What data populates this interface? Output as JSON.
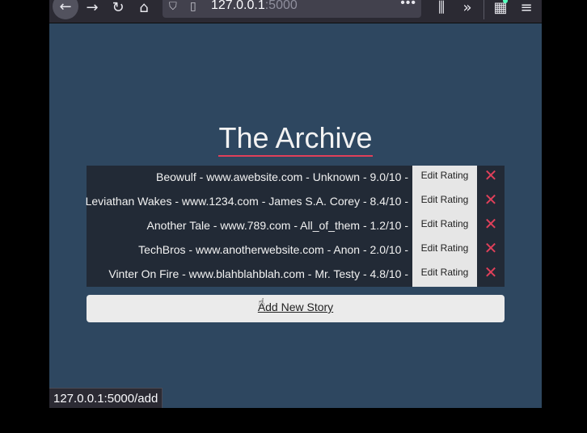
{
  "browser": {
    "url_host": "127.0.0.1",
    "url_port": ":5000",
    "status_url": "127.0.0.1:5000/add",
    "icons": {
      "back": "arrow-left-icon",
      "forward": "arrow-right-icon",
      "reload": "reload-icon",
      "home": "home-icon",
      "shield": "shield-icon",
      "page": "page-icon",
      "more": "more-dots-icon",
      "library": "library-icon",
      "overflow": "double-chevron-icon",
      "extensions": "extensions-icon",
      "menu": "hamburger-menu-icon"
    }
  },
  "page": {
    "title": "The Archive",
    "stories": [
      {
        "text": "Beowulf - www.awebsite.com - Unknown - 9.0/10 -",
        "edit_label": "Edit Rating",
        "delete_label": "✕"
      },
      {
        "text": "Leviathan Wakes - www.1234.com - James S.A. Corey - 8.4/10 -",
        "edit_label": "Edit Rating",
        "delete_label": "✕"
      },
      {
        "text": "Another Tale - www.789.com - All_of_them - 1.2/10 -",
        "edit_label": "Edit Rating",
        "delete_label": "✕"
      },
      {
        "text": "TechBros - www.anotherwebsite.com - Anon - 2.0/10 -",
        "edit_label": "Edit Rating",
        "delete_label": "✕"
      },
      {
        "text": "Vinter On Fire - www.blahblahblah.com - Mr. Testy - 4.8/10 -",
        "edit_label": "Edit Rating",
        "delete_label": "✕"
      }
    ],
    "add_label": "Add New Story"
  },
  "colors": {
    "page_background": "#2e4760",
    "table_background": "#222a36",
    "accent_red": "#e0405a",
    "button_light": "#e6e6e6"
  }
}
